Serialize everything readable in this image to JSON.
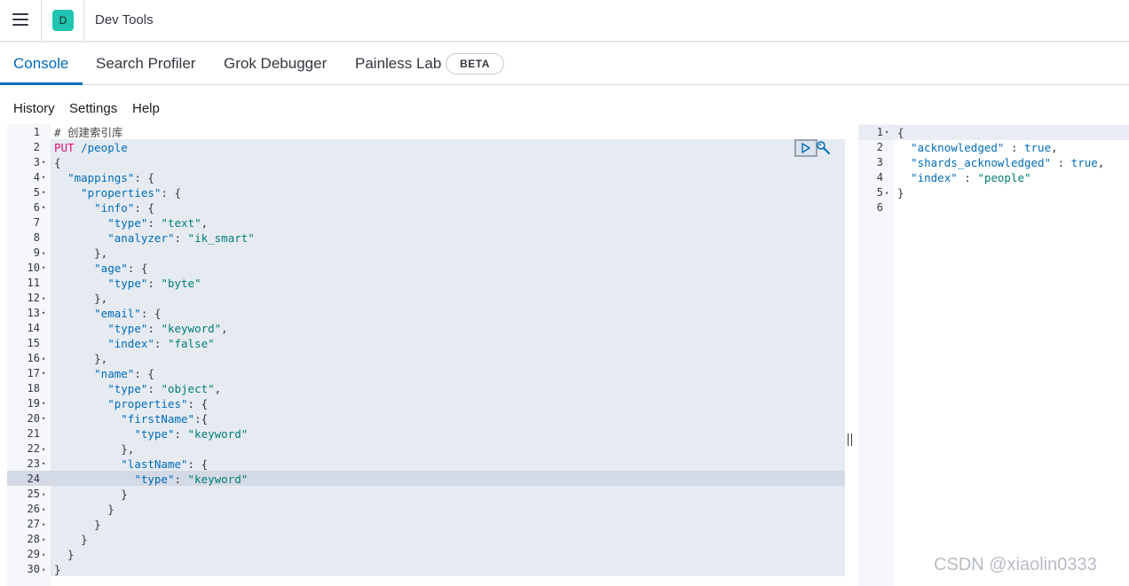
{
  "header": {
    "app_badge": "D",
    "title": "Dev Tools"
  },
  "tabs": [
    {
      "label": "Console",
      "active": true
    },
    {
      "label": "Search Profiler"
    },
    {
      "label": "Grok Debugger"
    },
    {
      "label": "Painless Lab",
      "badge": "BETA"
    }
  ],
  "toolbar": {
    "history": "History",
    "settings": "Settings",
    "help": "Help"
  },
  "editor": {
    "active_line": 24,
    "lines": [
      {
        "n": "1",
        "fold": "",
        "text": "# 创建索引库"
      },
      {
        "n": "2",
        "fold": "",
        "text": "PUT /people"
      },
      {
        "n": "3",
        "fold": "▾",
        "text": "{"
      },
      {
        "n": "4",
        "fold": "▾",
        "text": "  \"mappings\": {"
      },
      {
        "n": "5",
        "fold": "▾",
        "text": "    \"properties\": {"
      },
      {
        "n": "6",
        "fold": "▾",
        "text": "      \"info\": {"
      },
      {
        "n": "7",
        "fold": "",
        "text": "        \"type\": \"text\","
      },
      {
        "n": "8",
        "fold": "",
        "text": "        \"analyzer\": \"ik_smart\""
      },
      {
        "n": "9",
        "fold": "▴",
        "text": "      },"
      },
      {
        "n": "10",
        "fold": "▾",
        "text": "      \"age\": {"
      },
      {
        "n": "11",
        "fold": "",
        "text": "        \"type\": \"byte\""
      },
      {
        "n": "12",
        "fold": "▴",
        "text": "      },"
      },
      {
        "n": "13",
        "fold": "▾",
        "text": "      \"email\": {"
      },
      {
        "n": "14",
        "fold": "",
        "text": "        \"type\": \"keyword\","
      },
      {
        "n": "15",
        "fold": "",
        "text": "        \"index\": \"false\""
      },
      {
        "n": "16",
        "fold": "▴",
        "text": "      },"
      },
      {
        "n": "17",
        "fold": "▾",
        "text": "      \"name\": {"
      },
      {
        "n": "18",
        "fold": "",
        "text": "        \"type\": \"object\","
      },
      {
        "n": "19",
        "fold": "▾",
        "text": "        \"properties\": {"
      },
      {
        "n": "20",
        "fold": "▾",
        "text": "          \"firstName\":{"
      },
      {
        "n": "21",
        "fold": "",
        "text": "            \"type\": \"keyword\""
      },
      {
        "n": "22",
        "fold": "▴",
        "text": "          },"
      },
      {
        "n": "23",
        "fold": "▾",
        "text": "          \"lastName\": {"
      },
      {
        "n": "24",
        "fold": "",
        "text": "            \"type\": \"keyword\""
      },
      {
        "n": "25",
        "fold": "▴",
        "text": "          }"
      },
      {
        "n": "26",
        "fold": "▴",
        "text": "        }"
      },
      {
        "n": "27",
        "fold": "▴",
        "text": "      }"
      },
      {
        "n": "28",
        "fold": "▴",
        "text": "    }"
      },
      {
        "n": "29",
        "fold": "▴",
        "text": "  }"
      },
      {
        "n": "30",
        "fold": "▴",
        "text": "}"
      }
    ]
  },
  "output": {
    "lines": [
      {
        "n": "1",
        "fold": "▾",
        "text": "{"
      },
      {
        "n": "2",
        "fold": "",
        "text": "  \"acknowledged\" : true,"
      },
      {
        "n": "3",
        "fold": "",
        "text": "  \"shards_acknowledged\" : true,"
      },
      {
        "n": "4",
        "fold": "",
        "text": "  \"index\" : \"people\""
      },
      {
        "n": "5",
        "fold": "▴",
        "text": "}"
      },
      {
        "n": "6",
        "fold": "",
        "text": ""
      }
    ]
  },
  "icons": {
    "menu": "hamburger-menu-icon",
    "run": "play-icon",
    "wrench": "wrench-icon"
  },
  "watermark": "CSDN @xiaolin0333"
}
